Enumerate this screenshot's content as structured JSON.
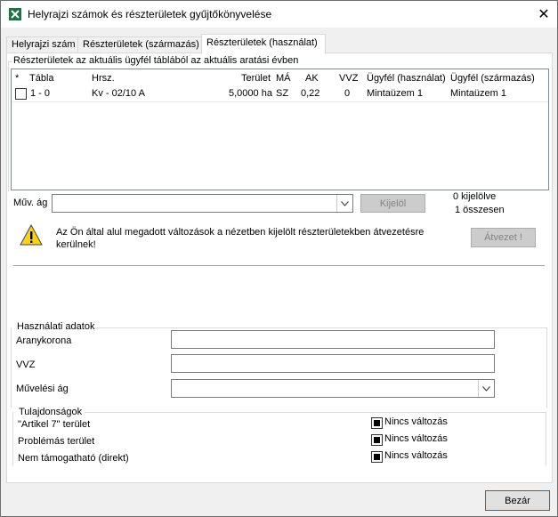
{
  "window": {
    "title": "Helyrajzi számok és részterületek gyűjtőkönyvelése"
  },
  "tabs": [
    {
      "label": "Helyrajzi szám"
    },
    {
      "label": "Részterületek (származás)"
    },
    {
      "label": "Részterületek (használat)"
    }
  ],
  "grid_section": {
    "title": "Részterületek az aktuális ügyfél táblából az aktuális aratási évben",
    "columns": [
      "*",
      "Tábla",
      "Hrsz.",
      "Terület",
      "MÁ",
      "AK",
      "VVZ",
      "Ügyfél (használat)",
      "Ügyfél (származás)"
    ],
    "rows": [
      {
        "tabla": "1 - 0",
        "hrsz": "Kv - 02/10 A",
        "terulet": "5,0000 ha",
        "ma": "SZ",
        "ak": "0,22",
        "vvz": "0",
        "ugyfel_hasznalat": "Mintaüzem 1",
        "ugyfel_szarmazas": "Mintaüzem 1"
      }
    ]
  },
  "filter": {
    "label": "Műv. ág",
    "value": "",
    "button": "Kijelöl",
    "selected_count": "0 kijelölve",
    "total_count": "1 összesen"
  },
  "warning": {
    "text_line1": "Az Ön által alul megadott változások a nézetben kijelölt részterületekben átvezetésre",
    "text_line2": "kerülnek!",
    "button": "Átvezet !"
  },
  "usage": {
    "title": "Használati adatok",
    "fields": [
      {
        "label": "Aranykorona",
        "value": ""
      },
      {
        "label": "VVZ",
        "value": ""
      },
      {
        "label": "Művelési ág",
        "value": ""
      }
    ]
  },
  "properties": {
    "title": "Tulajdonságok",
    "items": [
      {
        "label": "\"Artikel 7\" terület",
        "checkbox": "Nincs változás"
      },
      {
        "label": "Problémás terület",
        "checkbox": "Nincs változás"
      },
      {
        "label": "Nem támogatható (direkt)",
        "checkbox": "Nincs változás"
      }
    ]
  },
  "footer": {
    "close_button": "Bezár"
  }
}
